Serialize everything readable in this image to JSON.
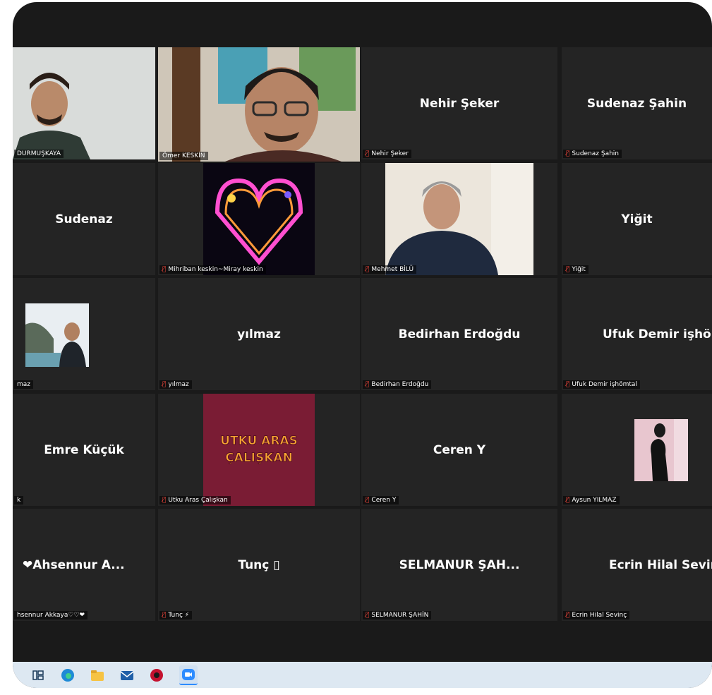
{
  "tiles": [
    {
      "name": "",
      "label": "DURMUŞKAYA",
      "mic_muted": false,
      "type": "video"
    },
    {
      "name": "",
      "label": "Ömer KESKİN",
      "mic_muted": false,
      "type": "video",
      "active": true
    },
    {
      "name": "Nehir Şeker",
      "label": "Nehir Şeker",
      "mic_muted": true
    },
    {
      "name": "Sudenaz Şahin",
      "label": "Sudenaz Şahin",
      "mic_muted": true
    },
    {
      "name": "Sudenaz",
      "label": "",
      "mic_muted": false
    },
    {
      "name": "",
      "label": "Mihriban keskin~Miray keskin",
      "mic_muted": true,
      "type": "image"
    },
    {
      "name": "",
      "label": "Mehmet BİLÜ",
      "mic_muted": true,
      "type": "video"
    },
    {
      "name": "Yiğit",
      "label": "Yiğit",
      "mic_muted": true
    },
    {
      "name": "",
      "label": "maz",
      "mic_muted": false,
      "type": "image"
    },
    {
      "name": "yılmaz",
      "label": "yılmaz",
      "mic_muted": true
    },
    {
      "name": "Bedirhan Erdoğdu",
      "label": "Bedirhan Erdoğdu",
      "mic_muted": true
    },
    {
      "name": "Ufuk Demir işhö..",
      "label": "Ufuk Demir işhömtal",
      "mic_muted": true
    },
    {
      "name": "Emre Küçük",
      "label": "k",
      "mic_muted": false
    },
    {
      "name": "",
      "label": "Utku Aras Çalışkan",
      "mic_muted": true,
      "type": "image",
      "image_text": [
        "UTKU ARAS",
        "ÇALIŞKAN"
      ]
    },
    {
      "name": "Ceren Y",
      "label": "Ceren Y",
      "mic_muted": true
    },
    {
      "name": "",
      "label": "Aysun YILMAZ",
      "mic_muted": true,
      "type": "image"
    },
    {
      "name": "❤Ahsennur A...",
      "label": "hsennur Akkaya♡♡❤",
      "mic_muted": false
    },
    {
      "name": "Tunç ▯",
      "label": "Tunç ⚡",
      "mic_muted": true
    },
    {
      "name": "SELMANUR ŞAH...",
      "label": "SELMANUR ŞAHİN",
      "mic_muted": true
    },
    {
      "name": "Ecrin Hilal Sevinç",
      "label": "Ecrin Hilal Sevinç",
      "mic_muted": true
    }
  ],
  "taskbar": {
    "icons": [
      "task-view-icon",
      "edge-icon",
      "file-explorer-icon",
      "mail-icon",
      "app-icon",
      "zoom-icon"
    ]
  },
  "colors": {
    "tile_bg": "#242424",
    "active_border": "#d8e86a",
    "muted_mic": "#e8443a",
    "taskbar": "#dde8f2"
  }
}
